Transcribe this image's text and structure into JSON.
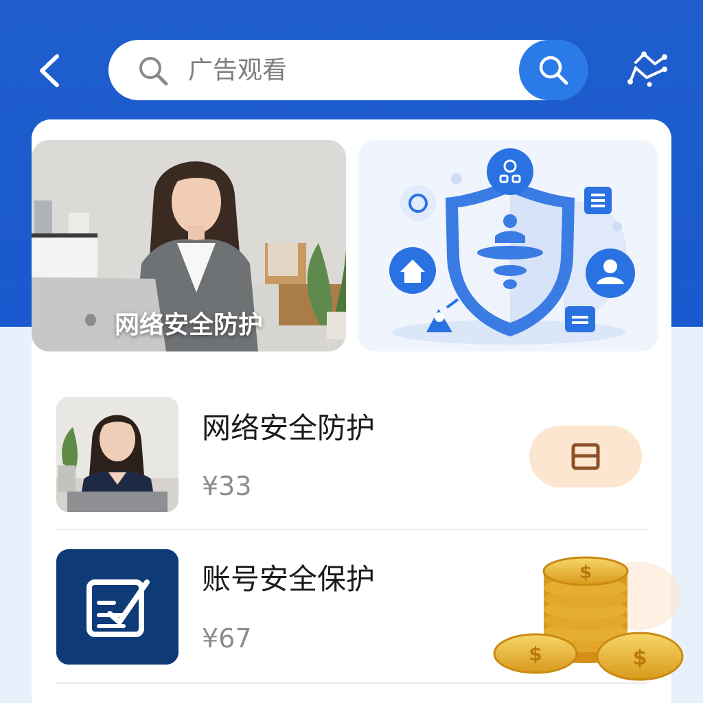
{
  "search": {
    "placeholder": "广告观看"
  },
  "banners": [
    {
      "title": "网络安全防护"
    }
  ],
  "items": [
    {
      "title": "网络安全防护",
      "price": "¥33"
    },
    {
      "title": "账号安全保护",
      "price": "¥67"
    }
  ],
  "icons": {
    "back": "back-arrow-icon",
    "search": "search-icon",
    "scan": "scan-icon",
    "calendar": "calendar-icon",
    "edit": "edit-checklist-icon",
    "coins": "gold-coins-icon"
  },
  "colors": {
    "header_blue": "#1f5ecc",
    "accent_blue": "#2a7ae8",
    "pill_peach": "#fde6cf",
    "dark_navy": "#0e3a78"
  }
}
